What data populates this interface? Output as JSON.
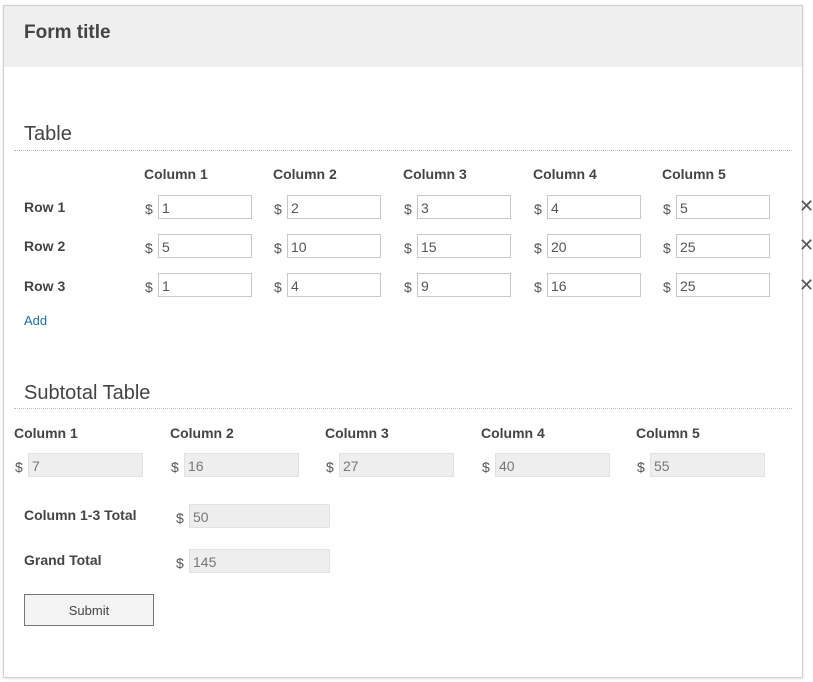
{
  "form": {
    "title": "Form title",
    "submit_label": "Submit"
  },
  "table": {
    "title": "Table",
    "columns": [
      "Column 1",
      "Column 2",
      "Column 3",
      "Column 4",
      "Column 5"
    ],
    "currency": "$",
    "remove_icon": "close-icon",
    "add_label": "Add",
    "rows": [
      {
        "label": "Row 1",
        "values": [
          "1",
          "2",
          "3",
          "4",
          "5"
        ]
      },
      {
        "label": "Row 2",
        "values": [
          "5",
          "10",
          "15",
          "20",
          "25"
        ]
      },
      {
        "label": "Row 3",
        "values": [
          "1",
          "4",
          "9",
          "16",
          "25"
        ]
      }
    ]
  },
  "subtotal": {
    "title": "Subtotal Table",
    "columns": [
      "Column 1",
      "Column 2",
      "Column 3",
      "Column 4",
      "Column 5"
    ],
    "values": [
      "7",
      "16",
      "27",
      "40",
      "55"
    ]
  },
  "totals": {
    "col13_label": "Column 1-3 Total",
    "col13_value": "50",
    "grand_label": "Grand Total",
    "grand_value": "145"
  },
  "colors": {
    "header_bg": "#efefef",
    "link": "#1f6fb2",
    "readonly_bg": "#eeeeee"
  }
}
